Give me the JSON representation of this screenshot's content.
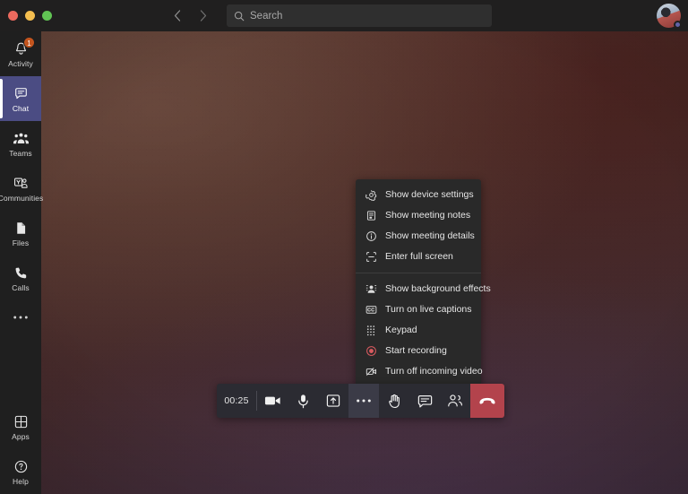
{
  "window": {
    "traffic_lights": [
      "close",
      "minimize",
      "zoom"
    ],
    "colors": {
      "close": "#ec6a5e",
      "minimize": "#f4be4f",
      "zoom": "#61c454"
    }
  },
  "titlebar": {
    "back_icon": "chevron-left-icon",
    "forward_icon": "chevron-right-icon",
    "back_glyph": "‹",
    "forward_glyph": "›",
    "search": {
      "icon": "search-icon",
      "placeholder": "Search",
      "value": ""
    },
    "avatar": {
      "name": "user-avatar",
      "presence": "available"
    }
  },
  "sidebar": {
    "items": [
      {
        "label": "Activity",
        "icon": "bell-icon",
        "badge": "1",
        "selected": false
      },
      {
        "label": "Chat",
        "icon": "chat-bubble-icon",
        "badge": "",
        "selected": true
      },
      {
        "label": "Teams",
        "icon": "people-team-icon",
        "badge": "",
        "selected": false
      },
      {
        "label": "Communities",
        "icon": "communities-icon",
        "badge": "",
        "selected": false
      },
      {
        "label": "Files",
        "icon": "file-icon",
        "badge": "",
        "selected": false
      },
      {
        "label": "Calls",
        "icon": "phone-icon",
        "badge": "",
        "selected": false
      }
    ],
    "more": {
      "label": "",
      "icon": "more-horizontal-icon"
    },
    "bottom_items": [
      {
        "label": "Apps",
        "icon": "apps-grid-icon"
      },
      {
        "label": "Help",
        "icon": "help-circle-icon"
      }
    ],
    "badge_color": "#c4551e",
    "selected_color": "#4b4c83"
  },
  "stage": {
    "name": "video-stage",
    "description": "dark blurred video feed"
  },
  "overflow_menu": {
    "groups": [
      {
        "items": [
          {
            "label": "Show device settings",
            "icon": "gear-icon"
          },
          {
            "label": "Show meeting notes",
            "icon": "notes-icon"
          },
          {
            "label": "Show meeting details",
            "icon": "info-circle-icon"
          },
          {
            "label": "Enter full screen",
            "icon": "fullscreen-icon"
          }
        ]
      },
      {
        "items": [
          {
            "label": "Show background effects",
            "icon": "background-effects-icon"
          },
          {
            "label": "Turn on live captions",
            "icon": "closed-captions-icon"
          },
          {
            "label": "Keypad",
            "icon": "keypad-icon"
          },
          {
            "label": "Start recording",
            "icon": "record-icon"
          },
          {
            "label": "Turn off incoming video",
            "icon": "video-off-icon"
          }
        ]
      }
    ]
  },
  "call_controls": {
    "timer": "00:25",
    "buttons": [
      {
        "name": "camera-toggle",
        "icon": "camera-icon",
        "active": false
      },
      {
        "name": "mic-toggle",
        "icon": "microphone-icon",
        "active": false
      },
      {
        "name": "share-screen",
        "icon": "share-screen-icon",
        "active": false
      },
      {
        "name": "more-options",
        "icon": "more-horizontal-icon",
        "active": true
      },
      {
        "name": "raise-hand",
        "icon": "raise-hand-icon",
        "active": false
      },
      {
        "name": "show-conversation",
        "icon": "chat-bubble-icon",
        "active": false
      },
      {
        "name": "show-participants",
        "icon": "people-icon",
        "active": false
      }
    ],
    "hangup": {
      "name": "hang-up",
      "icon": "phone-hangup-icon",
      "color": "#b3434c"
    }
  }
}
